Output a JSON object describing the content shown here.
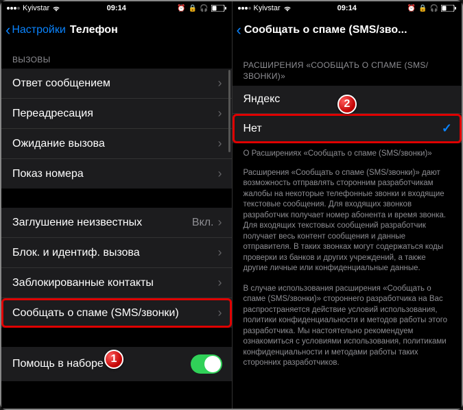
{
  "status": {
    "carrier": "Kyivstar",
    "time": "09:14"
  },
  "left": {
    "back_label": "Настройки",
    "title": "Телефон",
    "section_calls": "ВЫЗОВЫ",
    "rows": {
      "respond": "Ответ сообщением",
      "forwarding": "Переадресация",
      "waiting": "Ожидание вызова",
      "caller_id": "Показ номера",
      "silence": "Заглушение неизвестных",
      "silence_value": "Вкл.",
      "block_id": "Блок. и идентиф. вызова",
      "blocked": "Заблокированные контакты",
      "report_spam": "Сообщать о спаме (SMS/звонки)",
      "dial_assist": "Помощь в наборе"
    }
  },
  "right": {
    "title": "Сообщать о спаме (SMS/зво...",
    "section": "РАСШИРЕНИЯ «СООБЩАТЬ О СПАМЕ (SMS/ЗВОНКИ)»",
    "opt_yandex": "Яндекс",
    "opt_none": "Нет",
    "about": "О Расширениях «Сообщать о спаме (SMS/звонки)»",
    "para1": "Расширения «Сообщать о спаме (SMS/звонки)» дают возможность отправлять сторонним разработчикам жалобы на некоторые телефонные звонки и входящие текстовые сообщения. Для входящих звонков разработчик получает номер абонента и время звонка. Для входящих текстовых сообщений разработчик получает весь контент сообщения и данные отправителя. В таких звонках могут содержаться коды проверки из банков и других учреждений, а также другие личные или конфиденциальные данные.",
    "para2": "В случае использования расширения «Сообщать о спаме (SMS/звонки)» стороннего разработчика на Вас распространяется действие условий использования, политики конфиденциальности и методов работы этого разработчика. Мы настоятельно рекомендуем ознакомиться с условиями использования, политиками конфиденциальности и методами работы таких сторонних разработчиков."
  },
  "badges": {
    "one": "1",
    "two": "2"
  }
}
